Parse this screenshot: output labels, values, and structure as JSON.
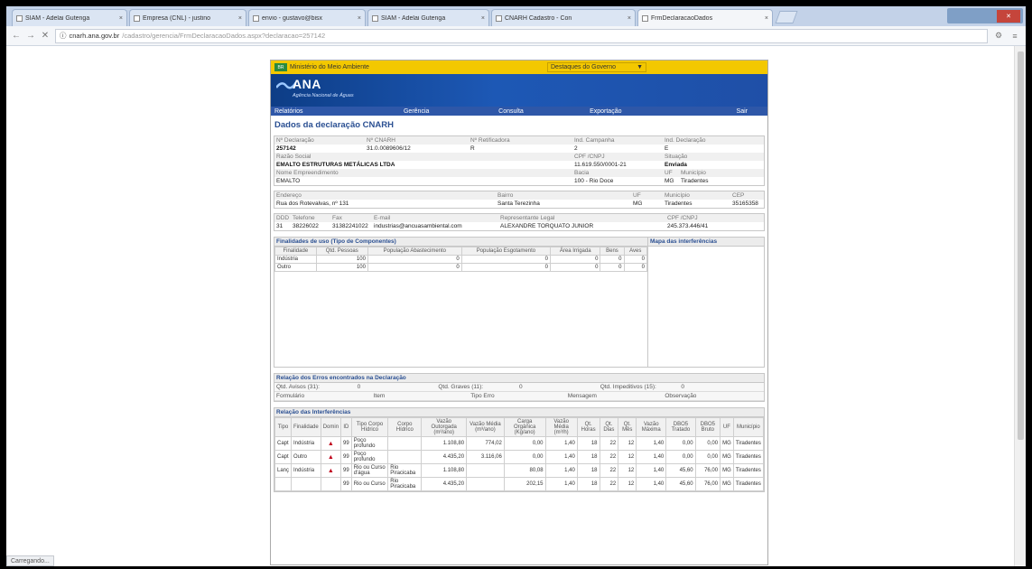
{
  "browser": {
    "tabs": [
      {
        "label": "SIAM - Adelai Gutenga"
      },
      {
        "label": "Empresa (CNL) - justino"
      },
      {
        "label": "envio - gustavo@bisx"
      },
      {
        "label": "SIAM - Adelai Gutenga"
      },
      {
        "label": "CNARH Cadastro - Con"
      },
      {
        "label": "FrmDeclaracaoDados",
        "active": true
      }
    ],
    "address_host": "cnarh.ana.gov.br",
    "address_path": "/cadastro/gerencia/FrmDeclaracaoDados.aspx?declaracao=257142",
    "status_text": "Carregando..."
  },
  "page": {
    "gov_bar": "Ministério do Meio Ambiente",
    "gov_flag": "BR",
    "destinations": "Destaques do Governo",
    "brand": "ANA",
    "brand_sub": "Agência Nacional de Águas",
    "menu": [
      "Relatórios",
      "Gerência",
      "Consulta",
      "Exportação",
      "Sair"
    ],
    "title": "Dados da declaração CNARH",
    "declaration": {
      "labels": [
        "Nº Declaração",
        "Nº CNARH",
        "Nº Retificadora",
        "Ind. Campanha",
        "Ind. Declaração"
      ],
      "values": [
        "257142",
        "31.0.0089606/12",
        "R",
        "2",
        "E"
      ],
      "razao_label": "Razão Social",
      "razao": "EMALTO ESTRUTURAS METÁLICAS LTDA",
      "cpf_label": "CPF /CNPJ",
      "cpf": "11.619.550/0001-21",
      "situacao_label": "Situação",
      "situacao": "Enviada",
      "emp_label": "Nome Empreendimento",
      "emp": "EMALTO",
      "bacia_label": "Bacia",
      "bacia": "100 - Rio Doce",
      "uf_label": "UF",
      "uf": "MG",
      "mun_label": "Município",
      "mun": "Tiradentes"
    },
    "address": {
      "labels": [
        "Endereço",
        "Bairro",
        "UF",
        "Município",
        "CEP"
      ],
      "values": [
        "Rua dos Rotevalvas, nº 131",
        "Santa Terezinha",
        "MG",
        "Tiradentes",
        "35165358"
      ]
    },
    "contact": {
      "labels": [
        "DDD",
        "Telefone",
        "Fax",
        "E-mail",
        "Representante Legal",
        "CPF /CNPJ"
      ],
      "values": [
        "31",
        "38226022",
        "31382241022",
        "industrias@ancuasambiental.com",
        "ALEXANDRE TORQUATO JUNIOR",
        "245.373.446/41"
      ]
    },
    "finalidades": {
      "heading": "Finalidades de uso (Tipo de Componentes)",
      "map_heading": "Mapa das interferências",
      "columns": [
        "Finalidade",
        "Qtd. Pessoas",
        "População Abastecimento",
        "População Esgotamento",
        "Área Irrigada",
        "Bens",
        "Aves"
      ],
      "rows": [
        [
          "Indústria",
          "100",
          "0",
          "0",
          "0",
          "0",
          "0"
        ],
        [
          "Outro",
          "100",
          "0",
          "0",
          "0",
          "0",
          "0"
        ]
      ]
    },
    "erros": {
      "heading": "Relação dos Erros encontrados na Declaração",
      "counts": [
        "Qtd. Avisos (31):",
        "0",
        "Qtd. Graves (11):",
        "0",
        "Qtd. Impeditivos (15):",
        "0"
      ],
      "columns": [
        "Formulário",
        "Item",
        "Tipo Erro",
        "Mensagem",
        "Observação"
      ]
    },
    "interferencias": {
      "heading": "Relação das Interferências",
      "columns": [
        "Tipo",
        "Finalidade",
        "Domin",
        "ID",
        "Tipo Corpo Hídrico",
        "Corpo Hídrico",
        "Vazão Outorgada (m³/ano)",
        "Vazão Média (m³/ano)",
        "Carga Orgânica (Kg/ano)",
        "Vazão Média (m³/h)",
        "Qt. Horas",
        "Qt. Dias",
        "Qt. Mês",
        "Vazão Máxima",
        "DBO5 Tratado",
        "DBO5 Bruto",
        "UF",
        "Município"
      ],
      "rows": [
        [
          "Capt",
          "Indústria",
          "▲",
          "99",
          "Poço profundo",
          "",
          "1.108,80",
          "774,02",
          "0,00",
          "1,40",
          "18",
          "22",
          "12",
          "1,40",
          "0,00",
          "0,00",
          "MG",
          "Tiradentes"
        ],
        [
          "Capt",
          "Outro",
          "▲",
          "99",
          "Poço profundo",
          "",
          "4.435,20",
          "3.116,06",
          "0,00",
          "1,40",
          "18",
          "22",
          "12",
          "1,40",
          "0,00",
          "0,00",
          "MG",
          "Tiradentes"
        ],
        [
          "Lanç",
          "Indústria",
          "▲",
          "99",
          "Rio ou Curso d'água",
          "Rio Piracicaba",
          "1.108,80",
          "",
          "80,08",
          "1,40",
          "18",
          "22",
          "12",
          "1,40",
          "45,60",
          "76,00",
          "MG",
          "Tiradentes"
        ],
        [
          "",
          "",
          "",
          "99",
          "Rio ou Curso",
          "Rio Piracicaba",
          "4.435,20",
          "",
          "202,15",
          "1,40",
          "18",
          "22",
          "12",
          "1,40",
          "45,60",
          "76,00",
          "MG",
          "Tiradentes"
        ]
      ]
    }
  }
}
